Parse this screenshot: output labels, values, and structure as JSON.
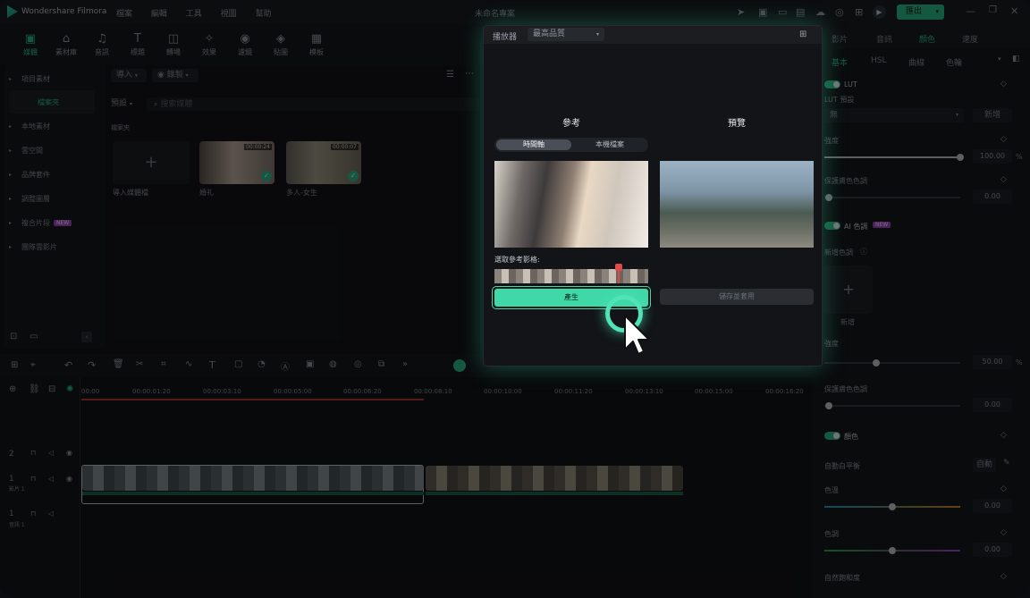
{
  "app": {
    "name": "Wondershare Filmora",
    "project_title": "未命名專案",
    "export_label": "匯出"
  },
  "menu": [
    "檔案",
    "編輯",
    "工具",
    "視圖",
    "幫助"
  ],
  "toolbar": [
    {
      "label": "媒體",
      "icon": "media-icon",
      "active": true
    },
    {
      "label": "素材庫",
      "icon": "stock-icon"
    },
    {
      "label": "音訊",
      "icon": "audio-icon"
    },
    {
      "label": "標題",
      "icon": "title-icon"
    },
    {
      "label": "轉場",
      "icon": "transition-icon"
    },
    {
      "label": "效果",
      "icon": "effects-icon"
    },
    {
      "label": "濾鏡",
      "icon": "filter-icon"
    },
    {
      "label": "貼圖",
      "icon": "sticker-icon"
    },
    {
      "label": "模板",
      "icon": "template-icon"
    }
  ],
  "sidebar": {
    "items": [
      {
        "label": "項目素材"
      },
      {
        "label": "檔案夾",
        "active": true
      },
      {
        "label": "本地素材"
      },
      {
        "label": "雲空間"
      },
      {
        "label": "品牌套件"
      },
      {
        "label": "調整圖層"
      },
      {
        "label": "複合片段",
        "badge": "NEW"
      },
      {
        "label": "團隊雲影片"
      }
    ]
  },
  "media": {
    "import_label": "導入",
    "record_label": "錄製",
    "sort_label": "預設",
    "search_placeholder": "搜索媒體",
    "folder_label": "檔案夾",
    "import_tile_label": "導入媒體檔",
    "clips": [
      {
        "name": "婚礼",
        "duration": "00:00:24"
      },
      {
        "name": "多人-女生",
        "duration": "00:00:07"
      }
    ]
  },
  "player": {
    "label": "播放器",
    "quality": "最高品質"
  },
  "ai_panel": {
    "reference_title": "參考",
    "preview_title": "預覽",
    "tabs": [
      "時間軸",
      "本機檔案"
    ],
    "select_frame_label": "選取參考影格:",
    "generate_button": "產生",
    "save_apply_button": "儲存並套用"
  },
  "right_panel": {
    "top_tabs": [
      "影片",
      "音訊",
      "顏色",
      "速度"
    ],
    "active_top_tab": "顏色",
    "sub_tabs": [
      "基本",
      "HSL",
      "曲線",
      "色輪"
    ],
    "active_sub_tab": "基本",
    "lut": {
      "title": "LUT",
      "preset_label": "LUT 預設",
      "preset_value": "無",
      "new_button": "新增",
      "strength_label": "強度",
      "strength_value": "100.00",
      "strength_unit": "%",
      "protect_label": "保護膚色色調",
      "protect_value": "0.00"
    },
    "ai_color": {
      "title": "AI 色調",
      "badge": "NEW",
      "add_color_label": "新增色調",
      "add_label": "新增",
      "strength_label": "強度",
      "strength_value": "50.00",
      "strength_unit": "%",
      "protect_label": "保護膚色色調",
      "protect_value": "0.00"
    },
    "color": {
      "title": "顏色",
      "wb_label": "自動白平衡",
      "auto_button": "自動",
      "temp_label": "色溫",
      "temp_value": "0.00",
      "tint_label": "色調",
      "tint_value": "0.00",
      "vibrance_label": "自然飽和度"
    }
  },
  "timeline": {
    "ruler": [
      "00:00",
      "00:00:01:20",
      "00:00:03:10",
      "00:00:05:00",
      "00:00:06:20",
      "00:00:08:10",
      "00:00:10:00",
      "00:00:11:20",
      "00:00:13:10",
      "00:00:15:00",
      "00:00:16:20"
    ],
    "tracks": [
      {
        "num": "2"
      },
      {
        "num": "1",
        "label": "影片 1"
      },
      {
        "num": "1",
        "label": "音訊 1"
      }
    ]
  },
  "colors": {
    "accent": "#2fc493",
    "bg": "#14161a",
    "panel": "#17191d"
  }
}
